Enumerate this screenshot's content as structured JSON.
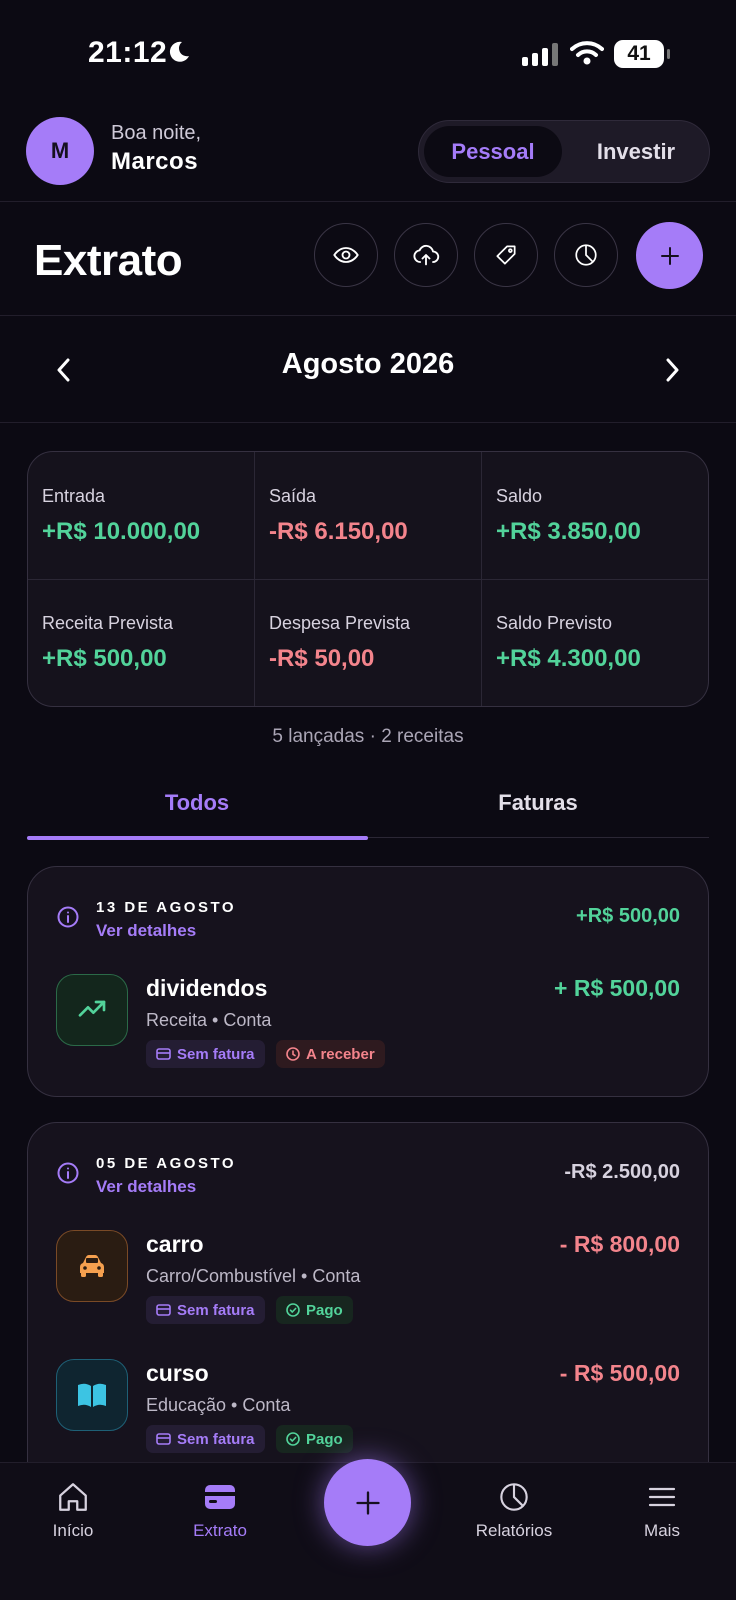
{
  "status_bar": {
    "time": "21:12",
    "battery": "41"
  },
  "header": {
    "avatar_initial": "M",
    "greeting": "Boa noite,",
    "user_name": "Marcos",
    "segments": [
      {
        "label": "Pessoal",
        "active": true
      },
      {
        "label": "Investir",
        "active": false
      }
    ]
  },
  "page": {
    "title": "Extrato",
    "actions": [
      "eye-icon",
      "cloud-upload-icon",
      "tag-icon",
      "pie-chart-icon",
      "plus-icon"
    ]
  },
  "month_nav": {
    "label": "Agosto 2026"
  },
  "summary": {
    "cells": [
      {
        "label": "Entrada",
        "value": "+R$ 10.000,00",
        "tone": "pos"
      },
      {
        "label": "Saída",
        "value": "-R$ 6.150,00",
        "tone": "neg"
      },
      {
        "label": "Saldo",
        "value": "+R$ 3.850,00",
        "tone": "pos"
      },
      {
        "label": "Receita Prevista",
        "value": "+R$ 500,00",
        "tone": "pos"
      },
      {
        "label": "Despesa Prevista",
        "value": "-R$ 50,00",
        "tone": "neg"
      },
      {
        "label": "Saldo Previsto",
        "value": "+R$ 4.300,00",
        "tone": "pos"
      }
    ],
    "count_text": "5 lançadas · 2 receitas"
  },
  "tabs": [
    {
      "label": "Todos",
      "active": true
    },
    {
      "label": "Faturas",
      "active": false
    }
  ],
  "groups": [
    {
      "date": "13 DE AGOSTO",
      "details_label": "Ver detalhes",
      "total": "+R$ 500,00",
      "items": [
        {
          "name": "dividendos",
          "subtitle": "Receita • Conta",
          "amount": "+ R$ 500,00",
          "icon": "trending-up-icon",
          "chips": [
            {
              "label": "Sem fatura",
              "style": "purple",
              "icon": "card-icon"
            },
            {
              "label": "A receber",
              "style": "red",
              "icon": "clock-icon"
            }
          ]
        }
      ]
    },
    {
      "date": "05 DE AGOSTO",
      "details_label": "Ver detalhes",
      "total": "-R$ 2.500,00",
      "items": [
        {
          "name": "carro",
          "subtitle": "Carro/Combustível • Conta",
          "amount": "- R$ 800,00",
          "icon": "car-icon",
          "chips": [
            {
              "label": "Sem fatura",
              "style": "purple",
              "icon": "card-icon"
            },
            {
              "label": "Pago",
              "style": "green",
              "icon": "check-circle-icon"
            }
          ]
        },
        {
          "name": "curso",
          "subtitle": "Educação • Conta",
          "amount": "- R$ 500,00",
          "icon": "book-icon",
          "chips": [
            {
              "label": "Sem fatura",
              "style": "purple",
              "icon": "card-icon"
            },
            {
              "label": "Pago",
              "style": "green",
              "icon": "check-circle-icon"
            }
          ]
        }
      ]
    }
  ],
  "bottom_nav": [
    {
      "label": "Início",
      "icon": "home-icon",
      "active": false
    },
    {
      "label": "Extrato",
      "icon": "wallet-icon",
      "active": true
    },
    {
      "label": "Relatórios",
      "icon": "pie-chart-icon",
      "active": false
    },
    {
      "label": "Mais",
      "icon": "menu-icon",
      "active": false
    }
  ],
  "colors": {
    "accent": "#a57cf8",
    "positive": "#52d39a",
    "negative": "#f3848c",
    "background": "#0c0a13"
  }
}
